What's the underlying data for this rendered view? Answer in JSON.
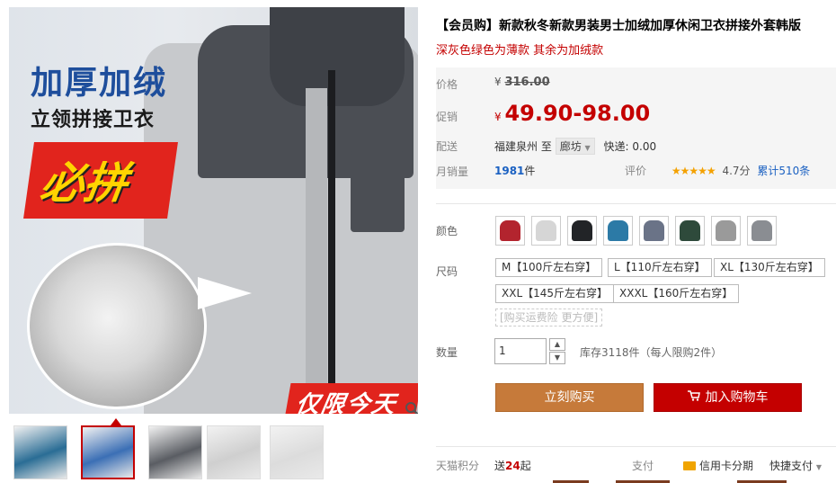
{
  "gallery": {
    "promo_title": "加厚加绒",
    "promo_subtitle": "立领拼接卫衣",
    "promo_badge": "必拼",
    "today_badge": "仅限今天",
    "zoom_icon": "magnifier-icon",
    "thumbnails": [
      {
        "name": "thumb-1",
        "color": "#2a6d95",
        "active": false
      },
      {
        "name": "thumb-2",
        "color": "#3b6fb5",
        "active": true
      },
      {
        "name": "thumb-3",
        "color": "#5a5d63",
        "active": false
      },
      {
        "name": "thumb-4",
        "color": "#cfcfcf",
        "active": false
      },
      {
        "name": "thumb-5",
        "color": "#dcdcdc",
        "active": false
      }
    ]
  },
  "product": {
    "title": "【会员购】新款秋冬新款男装男士加绒加厚休闲卫衣拼接外套韩版",
    "subtitle": "深灰色绿色为薄款 其余为加绒款"
  },
  "price": {
    "orig_label": "价格",
    "currency": "¥",
    "orig_value": "316.00",
    "promo_label": "促销",
    "promo_value": "49.90-98.00",
    "ship_label": "配送",
    "ship_from": "福建泉州",
    "ship_to_word": "至",
    "ship_dest": "廊坊",
    "express": "快递: 0.00",
    "sales_label": "月销量",
    "sales_count": "1981",
    "sales_unit": "件",
    "rating_label": "评价",
    "rating_stars": "★★★★★",
    "rating_score": "4.7分",
    "rating_total": "累计510条"
  },
  "options": {
    "color_label": "颜色",
    "colors": [
      {
        "name": "color-red",
        "hex": "#b3242e"
      },
      {
        "name": "color-light-grey",
        "hex": "#d6d6d6"
      },
      {
        "name": "color-black",
        "hex": "#222427"
      },
      {
        "name": "color-teal",
        "hex": "#2c7aa6"
      },
      {
        "name": "color-slate",
        "hex": "#6a7387"
      },
      {
        "name": "color-dark-green",
        "hex": "#2e4a3b"
      },
      {
        "name": "color-pattern",
        "hex": "#9a9a9a"
      },
      {
        "name": "color-grey",
        "hex": "#8a8d92"
      }
    ],
    "size_label": "尺码",
    "sizes": [
      "M【100斤左右穿】",
      "L【110斤左右穿】",
      "XL【130斤左右穿】",
      "XXL【145斤左右穿】",
      "XXXL【160斤左右穿】"
    ],
    "guarantee": "[购买运费险 更方便]",
    "qty_label": "数量",
    "qty_value": "1",
    "stock_text": "库存3118件（每人限购2件）"
  },
  "actions": {
    "buy_now": "立刻购买",
    "add_cart": "加入购物车"
  },
  "footer": {
    "points_label": "天猫积分",
    "points_prefix": "送",
    "points_value": "24",
    "points_suffix": "起",
    "pay_label": "支付",
    "credit": "信用卡分期",
    "quick_pay": "快捷支付"
  }
}
